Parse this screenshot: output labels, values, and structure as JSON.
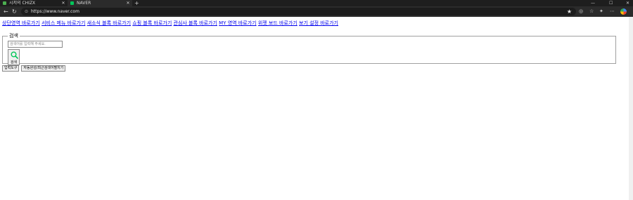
{
  "browser": {
    "tabs": [
      {
        "title": "시저의 CHIZX",
        "active": false
      },
      {
        "title": "NAVER",
        "active": true
      }
    ],
    "new_tab_label": "+",
    "url": "https://www.naver.com"
  },
  "page": {
    "skip_links": [
      "상단영역 바로가기",
      "서비스 메뉴 바로가기",
      "새소식 블록 바로가기",
      "쇼핑 블록 바로가기",
      "관심사 블록 바로가기",
      "MY 영역 바로가기",
      "위젯 보드 바로가기",
      "보기 설정 바로가기"
    ],
    "search": {
      "legend": "검색",
      "placeholder": "검색어를 입력해 주세요.",
      "button_label": "검색",
      "icon_color": "#03c75a"
    },
    "buttons": {
      "input_tool": "입력도구",
      "autocomplete": "자동완성/최근검색어펼치기"
    }
  }
}
